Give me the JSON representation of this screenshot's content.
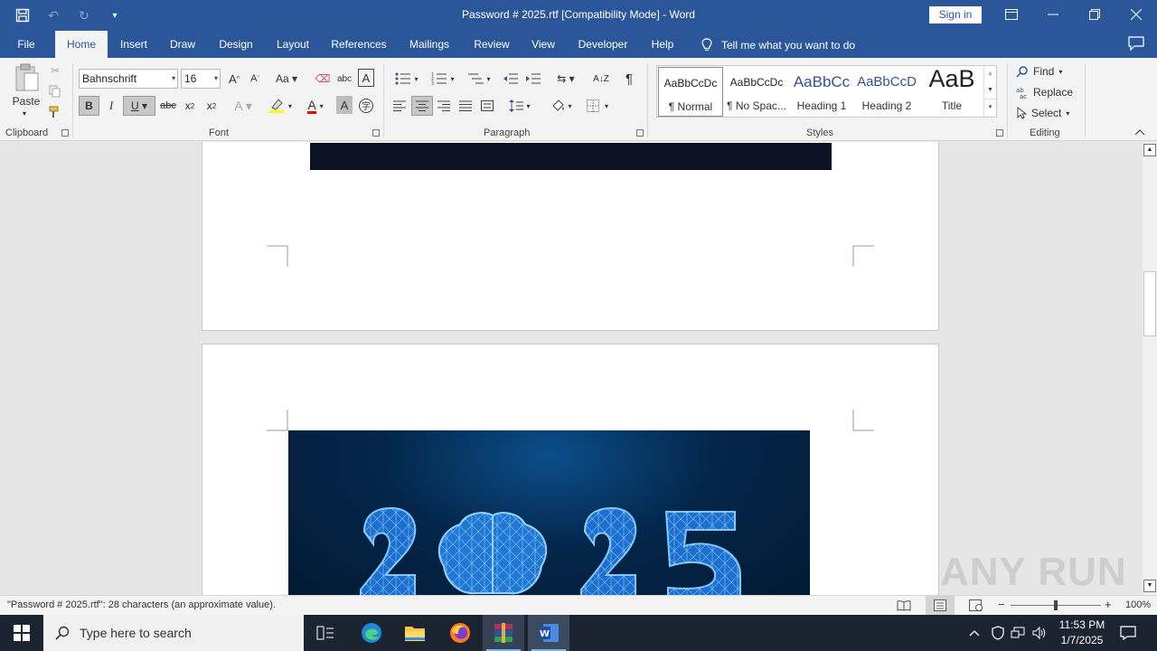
{
  "window": {
    "title": "Password # 2025.rtf [Compatibility Mode]  -  Word",
    "sign_in": "Sign in"
  },
  "tabs": [
    {
      "label": "File",
      "active": false
    },
    {
      "label": "Home",
      "active": true
    },
    {
      "label": "Insert",
      "active": false
    },
    {
      "label": "Draw",
      "active": false
    },
    {
      "label": "Design",
      "active": false
    },
    {
      "label": "Layout",
      "active": false
    },
    {
      "label": "References",
      "active": false
    },
    {
      "label": "Mailings",
      "active": false
    },
    {
      "label": "Review",
      "active": false
    },
    {
      "label": "View",
      "active": false
    },
    {
      "label": "Developer",
      "active": false
    },
    {
      "label": "Help",
      "active": false
    }
  ],
  "tell_me": "Tell me what you want to do",
  "ribbon": {
    "clipboard": {
      "paste": "Paste",
      "group": "Clipboard"
    },
    "font": {
      "name": "Bahnschrift",
      "size": "16",
      "group": "Font"
    },
    "paragraph": {
      "group": "Paragraph"
    },
    "styles": {
      "group": "Styles",
      "items": [
        {
          "sample": "AaBbCcDc",
          "name": "¶ Normal"
        },
        {
          "sample": "AaBbCcDc",
          "name": "¶ No Spac..."
        },
        {
          "sample": "AaBbCc",
          "name": "Heading 1"
        },
        {
          "sample": "AaBbCcD",
          "name": "Heading 2"
        },
        {
          "sample": "AaB",
          "name": "Title"
        }
      ]
    },
    "editing": {
      "find": "Find",
      "replace": "Replace",
      "select": "Select",
      "group": "Editing"
    }
  },
  "document": {
    "image_text": "2025"
  },
  "status": {
    "text": "\"Password # 2025.rtf\": 28 characters (an approximate value).",
    "zoom": "100%"
  },
  "taskbar": {
    "search_placeholder": "Type here to search",
    "time": "11:53 PM",
    "date": "1/7/2025"
  },
  "watermark": "ANY RUN",
  "colors": {
    "word_blue": "#2b579a",
    "taskbar": "#1c2432",
    "image_bg": "#021a33"
  }
}
